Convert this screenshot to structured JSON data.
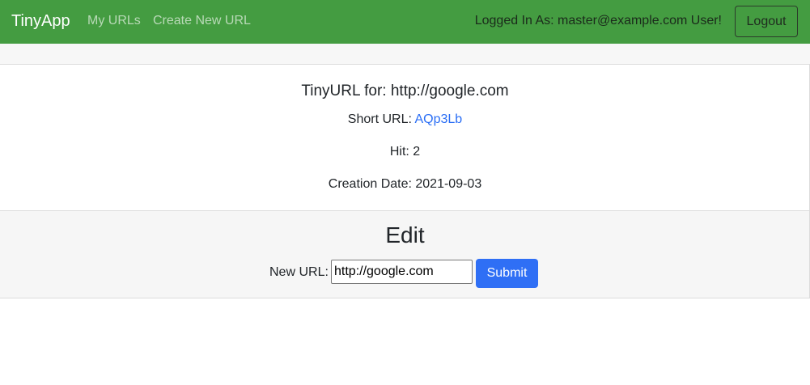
{
  "navbar": {
    "brand": "TinyApp",
    "links": [
      {
        "label": "My URLs"
      },
      {
        "label": "Create New URL"
      }
    ],
    "logged_in_text": "Logged In As: master@example.com User!",
    "logout_label": "Logout"
  },
  "url_details": {
    "title": "TinyURL for: http://google.com",
    "short_url_label": "Short URL:",
    "short_url": "AQp3Lb",
    "hit_text": "Hit: 2",
    "creation_date_text": "Creation Date: 2021-09-03"
  },
  "edit": {
    "title": "Edit",
    "new_url_label": "New URL:",
    "new_url_value": "http://google.com",
    "submit_label": "Submit"
  },
  "colors": {
    "navbar_bg": "#449c41",
    "link_blue": "#2a6ef5",
    "submit_bg": "#2f6ff5"
  }
}
